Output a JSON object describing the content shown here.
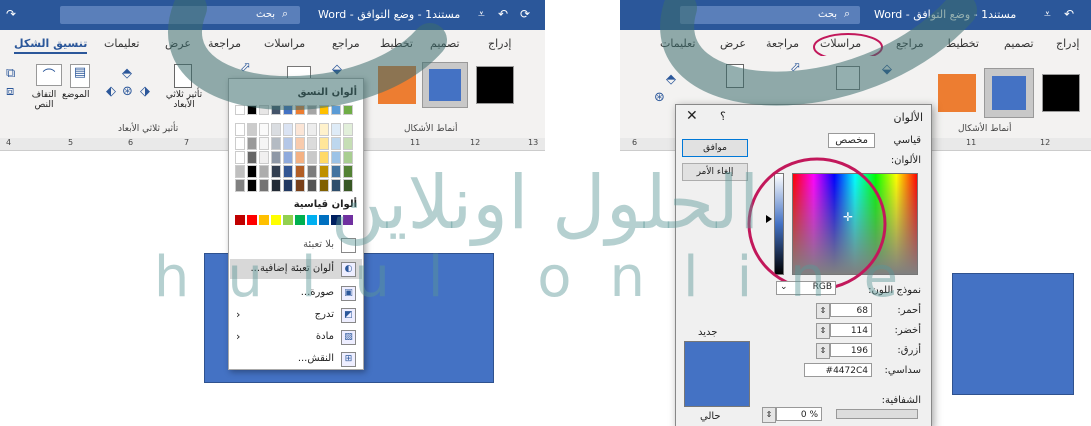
{
  "left": {
    "title": "مستند1 - وضع التوافق - Word",
    "search": "بحث",
    "tabs": [
      "تنسيق الشكل",
      "تعليمات",
      "عرض",
      "مراجعة",
      "مراسلات",
      "مراجع",
      "تخطيط",
      "تصميم",
      "إدراج"
    ],
    "ribbon_labels": {
      "wrap_text": "التفاف النص",
      "position": "الموضع",
      "effects_3d": "تأثير ثلاثي الأبعاد",
      "effects_3d_group": "تأثير ثلاثي الأبعاد",
      "shape_styles": "أنماط الأشكال"
    },
    "ruler_numbers": [
      "4",
      "5",
      "6",
      "7",
      "11",
      "12",
      "13"
    ],
    "dropdown": {
      "theme_colors": "ألوان النسق",
      "standard_colors": "ألوان قياسية",
      "no_fill": "بلا تعبئة",
      "more_colors": "ألوان تعبئة إضافية...",
      "picture": "صورة...",
      "gradient": "تدرج",
      "texture": "مادة",
      "pattern": "النقش..."
    },
    "theme_top": [
      "#ffffff",
      "#000000",
      "#e7e6e6",
      "#44546a",
      "#4472c4",
      "#ed7d31",
      "#a5a5a5",
      "#ffc000",
      "#5b9bd5",
      "#70ad47"
    ],
    "standard": [
      "#c00000",
      "#ff0000",
      "#ffc000",
      "#ffff00",
      "#92d050",
      "#00b050",
      "#00b0f0",
      "#0070c0",
      "#002060",
      "#7030a0"
    ]
  },
  "right": {
    "title": "مستند1 - وضع التوافق - Word",
    "search": "بحث",
    "tabs": [
      "إدراج",
      "تصميم",
      "تخطيط",
      "مراجع",
      "مراسلات",
      "مراجعة",
      "عرض",
      "تعليمات"
    ],
    "shape_styles": "أنماط الأشكال",
    "ruler_numbers": [
      "6",
      "11",
      "12"
    ],
    "dialog": {
      "title": "الألوان",
      "help": "؟",
      "tab_standard": "قياسي",
      "tab_custom": "مخصص",
      "ok": "موافق",
      "cancel": "إلغاء الأمر",
      "colors_label": "الألوان:",
      "model_label": "نموذج اللون:",
      "model_value": "RGB",
      "red_label": "أحمر:",
      "green_label": "أخضر:",
      "blue_label": "أزرق:",
      "hex_label": "سداسي:",
      "red": "68",
      "green": "114",
      "blue": "196",
      "hex": "#4472C4",
      "new_label": "جديد",
      "current_label": "حالي",
      "transparency_label": "الشفافية:",
      "transparency": "0 %"
    }
  },
  "watermark": {
    "arabic": "الحلول اونلاين",
    "latin": "hulul online"
  },
  "colors": {
    "word_blue": "#2b579a",
    "shape_fill": "#4472c4",
    "highlight_circle": "#c2185b",
    "orange": "#ed7d31",
    "black": "#000000"
  }
}
